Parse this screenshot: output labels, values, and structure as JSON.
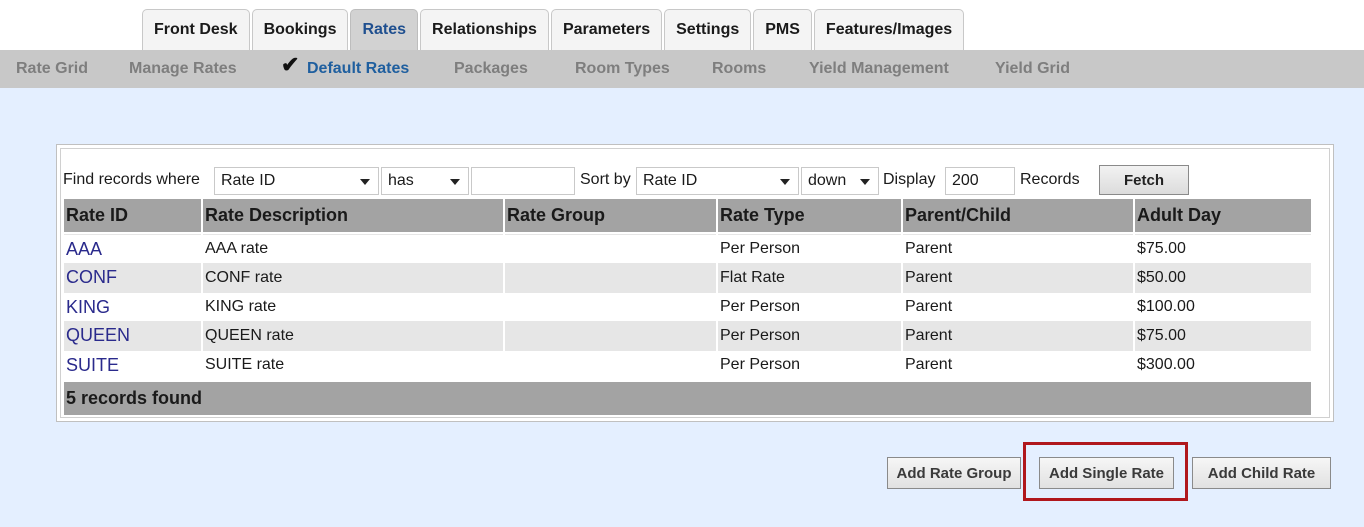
{
  "tabs": [
    "Front Desk",
    "Bookings",
    "Rates",
    "Relationships",
    "Parameters",
    "Settings",
    "PMS",
    "Features/Images"
  ],
  "subnav": [
    "Rate Grid",
    "Manage Rates",
    "Default Rates",
    "Packages",
    "Room Types",
    "Rooms",
    "Yield Management",
    "Yield Grid"
  ],
  "filter": {
    "find_label": "Find records where",
    "field_value": "Rate ID",
    "op_value": "has",
    "search_value": "",
    "sort_label": "Sort by",
    "sort_field_value": "Rate ID",
    "sort_dir_value": "down",
    "display_label": "Display",
    "display_value": "200",
    "records_label": "Records",
    "fetch_label": "Fetch"
  },
  "table": {
    "headers": [
      "Rate ID",
      "Rate Description",
      "Rate Group",
      "Rate Type",
      "Parent/Child",
      "Adult Day"
    ],
    "rows": [
      [
        "AAA",
        "AAA rate",
        "",
        "Per Person",
        "Parent",
        "$75.00"
      ],
      [
        "CONF",
        "CONF rate",
        "",
        "Flat Rate",
        "Parent",
        "$50.00"
      ],
      [
        "KING",
        "KING rate",
        "",
        "Per Person",
        "Parent",
        "$100.00"
      ],
      [
        "QUEEN",
        "QUEEN rate",
        "",
        "Per Person",
        "Parent",
        "$75.00"
      ],
      [
        "SUITE",
        "SUITE rate",
        "",
        "Per Person",
        "Parent",
        "$300.00"
      ]
    ],
    "footer": "5 records found"
  },
  "buttons": {
    "add_rate_group": "Add Rate Group",
    "add_single_rate": "Add Single Rate",
    "add_child_rate": "Add Child Rate"
  },
  "colors": {
    "accent": "#1f5f9f",
    "highlight": "#b0171d"
  }
}
